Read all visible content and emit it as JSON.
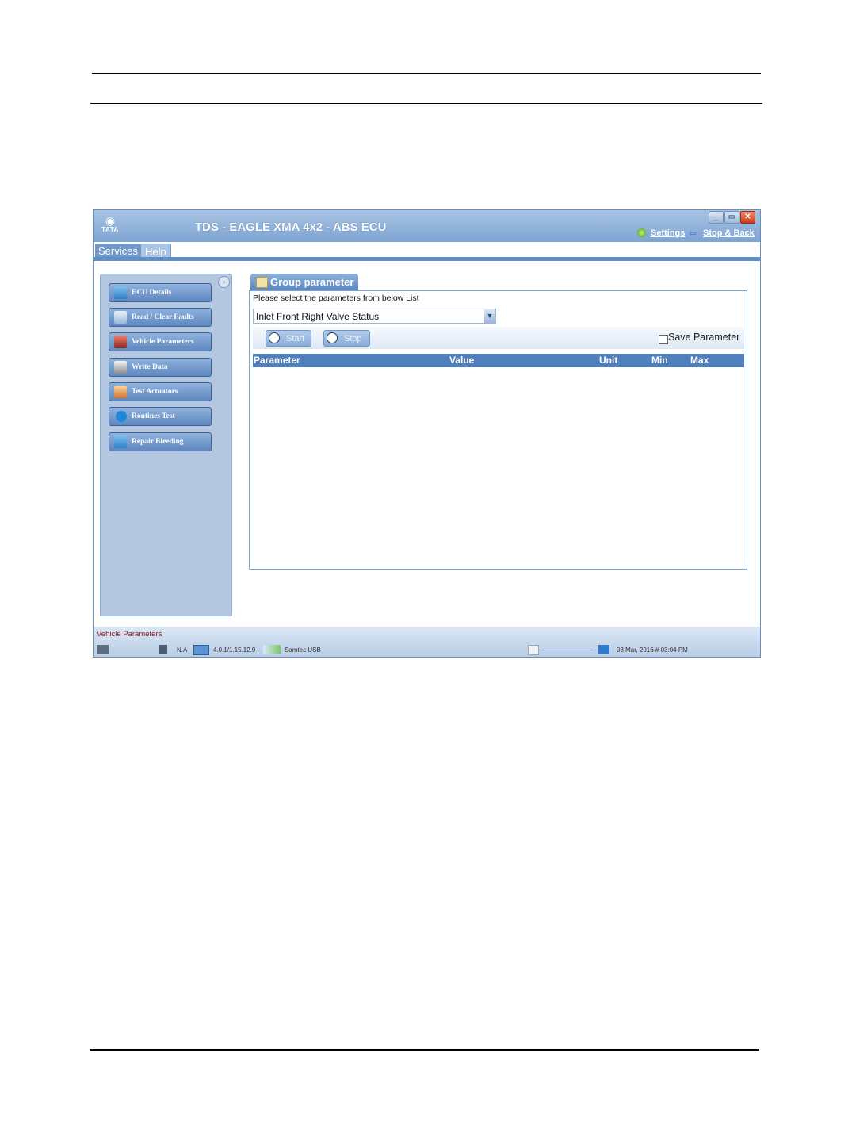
{
  "window": {
    "title": "TDS - EAGLE XMA 4x2 - ABS ECU",
    "logo_text": "TATA",
    "settings_label": "Settings",
    "back_label": "Stop & Back"
  },
  "tabs": [
    {
      "label": "Services",
      "active": true
    },
    {
      "label": "Help",
      "active": false
    }
  ],
  "sidebar": {
    "items": [
      {
        "label": "ECU Details",
        "icon": "ecu-icon"
      },
      {
        "label": "Read / Clear Faults",
        "icon": "stethoscope-icon"
      },
      {
        "label": "Vehicle Parameters",
        "icon": "parameters-icon"
      },
      {
        "label": "Write Data",
        "icon": "write-icon"
      },
      {
        "label": "Test Actuators",
        "icon": "actuator-icon"
      },
      {
        "label": "Routines Test",
        "icon": "play-icon"
      },
      {
        "label": "Repair Bleeding",
        "icon": "repair-icon"
      }
    ]
  },
  "group_parameter": {
    "tab_label": "Group parameter",
    "prompt": "Please select the parameters from below List",
    "selected_parameter": "Inlet Front Right Valve Status",
    "start_label": "Start",
    "stop_label": "Stop",
    "save_label": "Save Parameter",
    "save_checked": false,
    "columns": [
      "Parameter",
      "Value",
      "Unit",
      "Min",
      "Max"
    ],
    "rows": []
  },
  "status": {
    "current_page": "Vehicle Parameters",
    "na": "N.A",
    "version": "4.0.1/1.15.12.9",
    "interface": "Samtec USB",
    "datetime": "03 Mar, 2016 # 03:04 PM"
  },
  "colors": {
    "title_bar": "#7ea4d2",
    "sidebar_bg": "#b4c7e0",
    "table_header": "#4f7fbd"
  }
}
